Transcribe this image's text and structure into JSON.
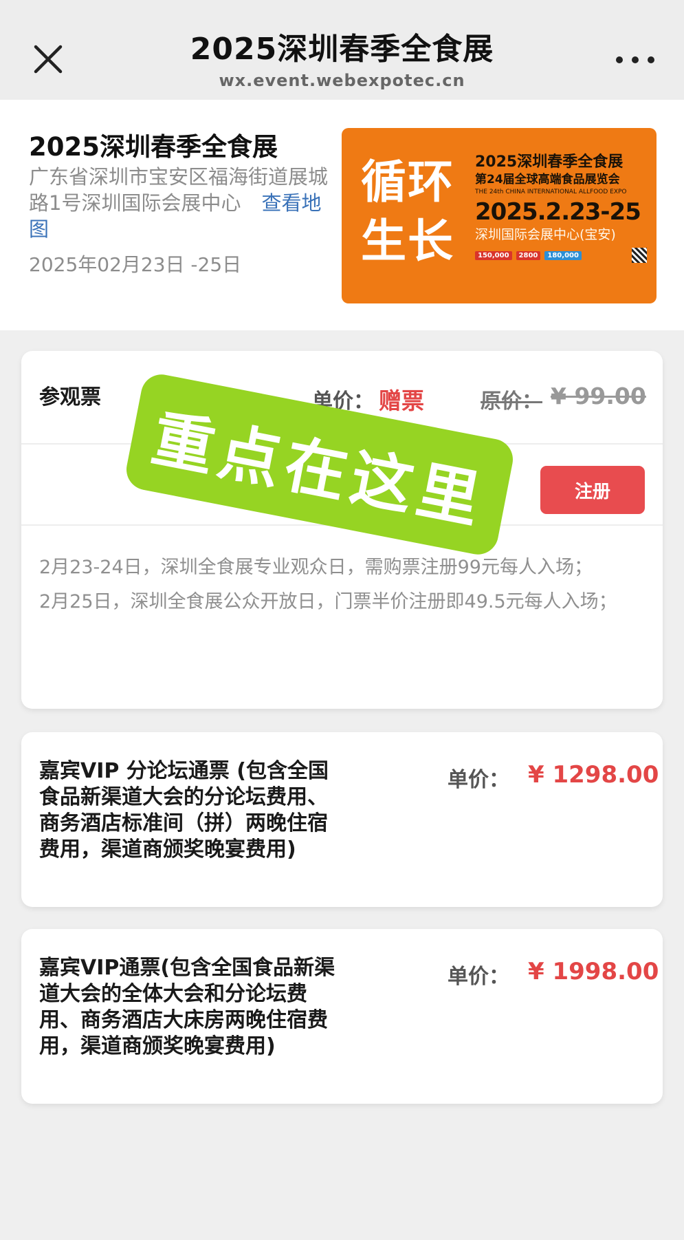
{
  "nav": {
    "title": "2025深圳春季全食展",
    "url": "wx.event.webexpotec.cn",
    "close_icon": "close-icon",
    "more_icon": "more-dots-icon"
  },
  "event": {
    "name": "2025深圳春季全食展",
    "address": "广东省深圳市宝安区福海街道展城路1号深圳国际会展中心",
    "map_link": "查看地图",
    "date": "2025年02月23日 -25日",
    "poster": {
      "slogan": "循环生长",
      "title": "2025深圳春季全食展",
      "subtitle": "第24届全球高端食品展览会",
      "english": "THE 24th CHINA INTERNATIONAL ALLFOOD EXPO",
      "dates": "2025.2.23-25",
      "venue": "深圳国际会展中心(宝安)",
      "stats": [
        "150,000",
        "2800",
        "180,000"
      ]
    }
  },
  "tickets": {
    "visitor": {
      "name": "参观票",
      "price_label": "单价：",
      "price": "赠票",
      "original_label": "原价：",
      "original_price": "¥ 99.00",
      "register_label": "注册",
      "note_1": "2月23-24日，深圳全食展专业观众日，需购票注册99元每人入场；",
      "note_2": "2月25日，深圳全食展公众开放日，门票半价注册即49.5元每人入场；"
    },
    "vip_forum": {
      "name": "嘉宾VIP 分论坛通票 (包含全国食品新渠道大会的分论坛费用、商务酒店标准间（拼）两晚住宿费用，渠道商颁奖晚宴费用)",
      "price_label": "单价：",
      "price": "¥ 1298.00"
    },
    "vip_full": {
      "name": "嘉宾VIP通票(包含全国食品新渠道大会的全体大会和分论坛费用、商务酒店大床房两晚住宿费用，渠道商颁奖晚宴费用)",
      "price_label": "单价：",
      "price": "¥ 1998.00"
    }
  },
  "overlay": {
    "text": "重点在这里",
    "color": "#96d423"
  },
  "colors": {
    "accent_red": "#e84c4f",
    "price_red": "#e34646",
    "link_blue": "#3a72b8",
    "poster_orange": "#ef7a14"
  }
}
